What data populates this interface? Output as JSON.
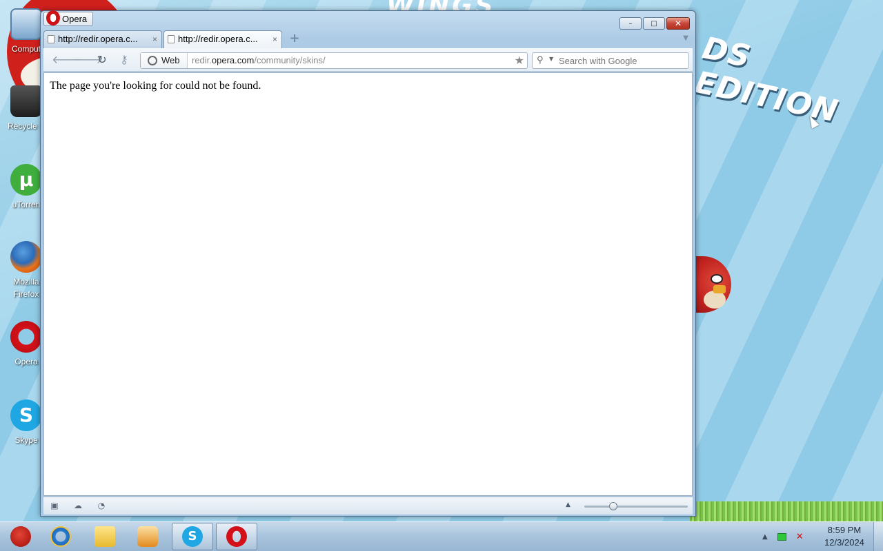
{
  "desktop": {
    "wallpaper_text_top": "WINGS",
    "wallpaper_text": "DS EDITION",
    "icons": [
      {
        "label": "Comput",
        "icon": "computer-icon"
      },
      {
        "label": "Recycle B",
        "icon": "recycle-bin-icon"
      },
      {
        "label": "uTorren",
        "icon": "utorrent-icon"
      },
      {
        "label": "Mozilla Firefox",
        "icon": "firefox-icon"
      },
      {
        "label": "Opera",
        "icon": "opera-icon"
      },
      {
        "label": "Skype",
        "icon": "skype-icon"
      }
    ]
  },
  "window": {
    "title": "Opera",
    "tabs": [
      {
        "title": "http://redir.opera.c...",
        "close": "×",
        "active": false
      },
      {
        "title": "http://redir.opera.c...",
        "close": "×",
        "active": true
      }
    ],
    "new_tab": "+",
    "tab_menu": "▼",
    "controls": {
      "minimize": "–",
      "maximize": "□",
      "close": "✕"
    }
  },
  "toolbar": {
    "back": "🡐",
    "forward": "🡒",
    "reload": "↻",
    "key": "⚷",
    "address_badge": "Web",
    "url_prefix": "redir.",
    "url_domain": "opera.com",
    "url_path": "/community/skins/",
    "bookmark_star": "★",
    "search_placeholder": "Search with Google",
    "search_icon": "⚲",
    "search_dropdown": "▼"
  },
  "page": {
    "message": "The page you're looking for could not be found."
  },
  "statusbar": {
    "panel_toggle": "▣",
    "turbo": "☁",
    "speed_dial": "◔",
    "zoom_menu": "▲",
    "zoom_level": 0.28
  },
  "taskbar": {
    "items": [
      {
        "name": "start-button",
        "open": false
      },
      {
        "name": "internet-explorer",
        "open": false
      },
      {
        "name": "windows-explorer",
        "open": false
      },
      {
        "name": "media-player",
        "open": false
      },
      {
        "name": "skype",
        "open": true
      },
      {
        "name": "opera",
        "open": true
      }
    ],
    "tray_arrow": "▲",
    "volume_mute": "✕",
    "time": "8:59 PM",
    "date": "12/3/2024"
  }
}
